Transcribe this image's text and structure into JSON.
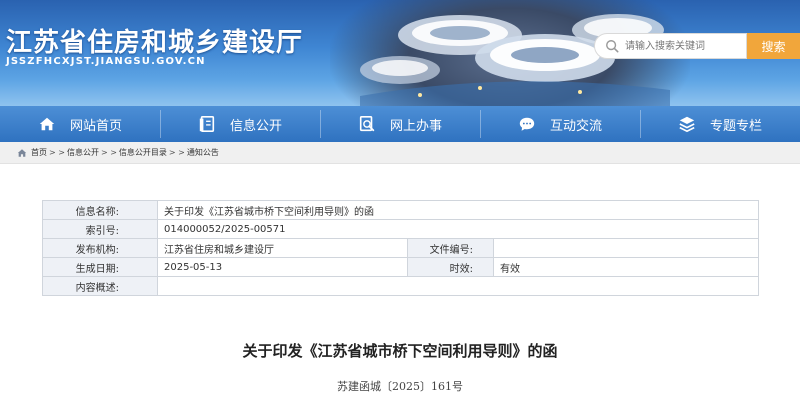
{
  "header": {
    "title": "江苏省住房和城乡建设厅",
    "url": "JSSZFHCXJST.JIANGSU.GOV.CN",
    "search_placeholder": "请输入搜索关键词",
    "search_button": "搜索"
  },
  "nav": {
    "items": [
      {
        "label": "网站首页",
        "icon": "home-icon"
      },
      {
        "label": "信息公开",
        "icon": "document-icon"
      },
      {
        "label": "网上办事",
        "icon": "search-file-icon"
      },
      {
        "label": "互动交流",
        "icon": "chat-icon"
      },
      {
        "label": "专题专栏",
        "icon": "layers-icon"
      }
    ]
  },
  "breadcrumb": {
    "items": [
      "首页",
      "信息公开",
      "信息公开目录",
      "通知公告"
    ],
    "separator": "> >"
  },
  "info": {
    "name_label": "信息名称:",
    "name_value": "关于印发《江苏省城市桥下空间利用导则》的函",
    "index_label": "索引号:",
    "index_value": "014000052/2025-00571",
    "publisher_label": "发布机构:",
    "publisher_value": "江苏省住房和城乡建设厅",
    "docno_label": "文件编号:",
    "docno_value": "",
    "date_label": "生成日期:",
    "date_value": "2025-05-13",
    "validity_label": "时效:",
    "validity_value": "有效",
    "summary_label": "内容概述:",
    "summary_value": ""
  },
  "document": {
    "title": "关于印发《江苏省城市桥下空间利用导则》的函",
    "number": "苏建函城〔2025〕161号"
  },
  "colors": {
    "nav_blue": "#2f72c0",
    "search_orange": "#f1a63b",
    "table_label_bg": "#eef1f6"
  }
}
